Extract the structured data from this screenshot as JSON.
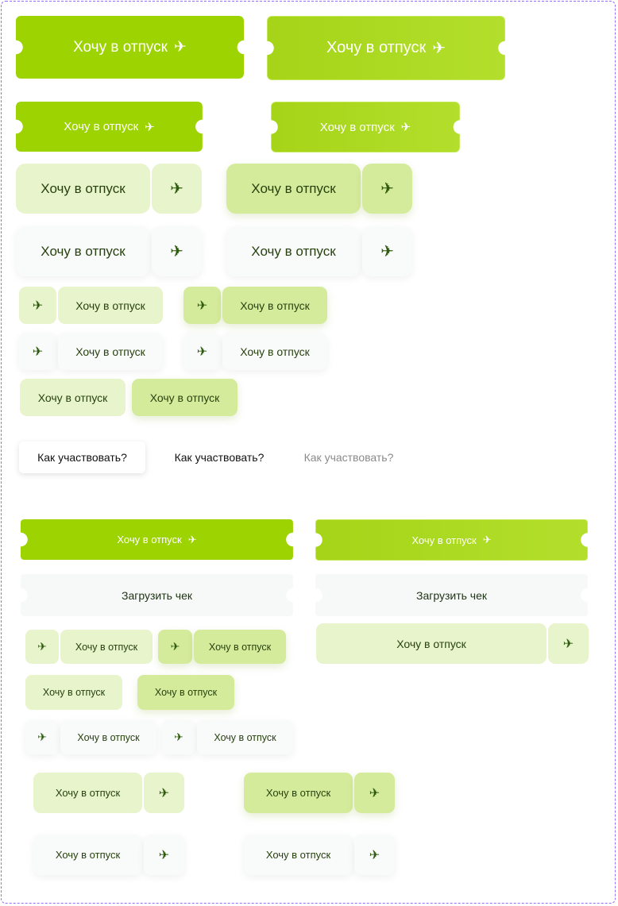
{
  "labels": {
    "vacation": "Хочу в отпуск",
    "how_to": "Как участвовать?",
    "upload": "Загрузить чек"
  },
  "icons": {
    "plane": "✈"
  },
  "colors": {
    "accent": "#9dd300",
    "accent_light": "#e8f4cc",
    "text_dark": "#28420f"
  }
}
